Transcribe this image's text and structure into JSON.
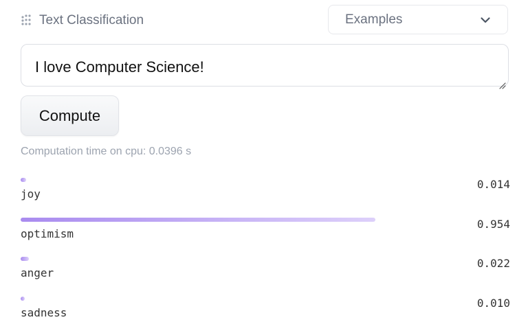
{
  "header": {
    "task_icon": "text-classification-icon",
    "task_label": "Text Classification"
  },
  "examples": {
    "label": "Examples",
    "icon": "chevron-down-icon"
  },
  "input": {
    "value": "I love Computer Science!"
  },
  "compute_button": {
    "label": "Compute"
  },
  "compute_time": "Computation time on cpu: 0.0396 s",
  "accent": "#a98bef",
  "results": [
    {
      "label": "joy",
      "score": "0.014",
      "value": 0.014
    },
    {
      "label": "optimism",
      "score": "0.954",
      "value": 0.954
    },
    {
      "label": "anger",
      "score": "0.022",
      "value": 0.022
    },
    {
      "label": "sadness",
      "score": "0.010",
      "value": 0.01
    }
  ]
}
